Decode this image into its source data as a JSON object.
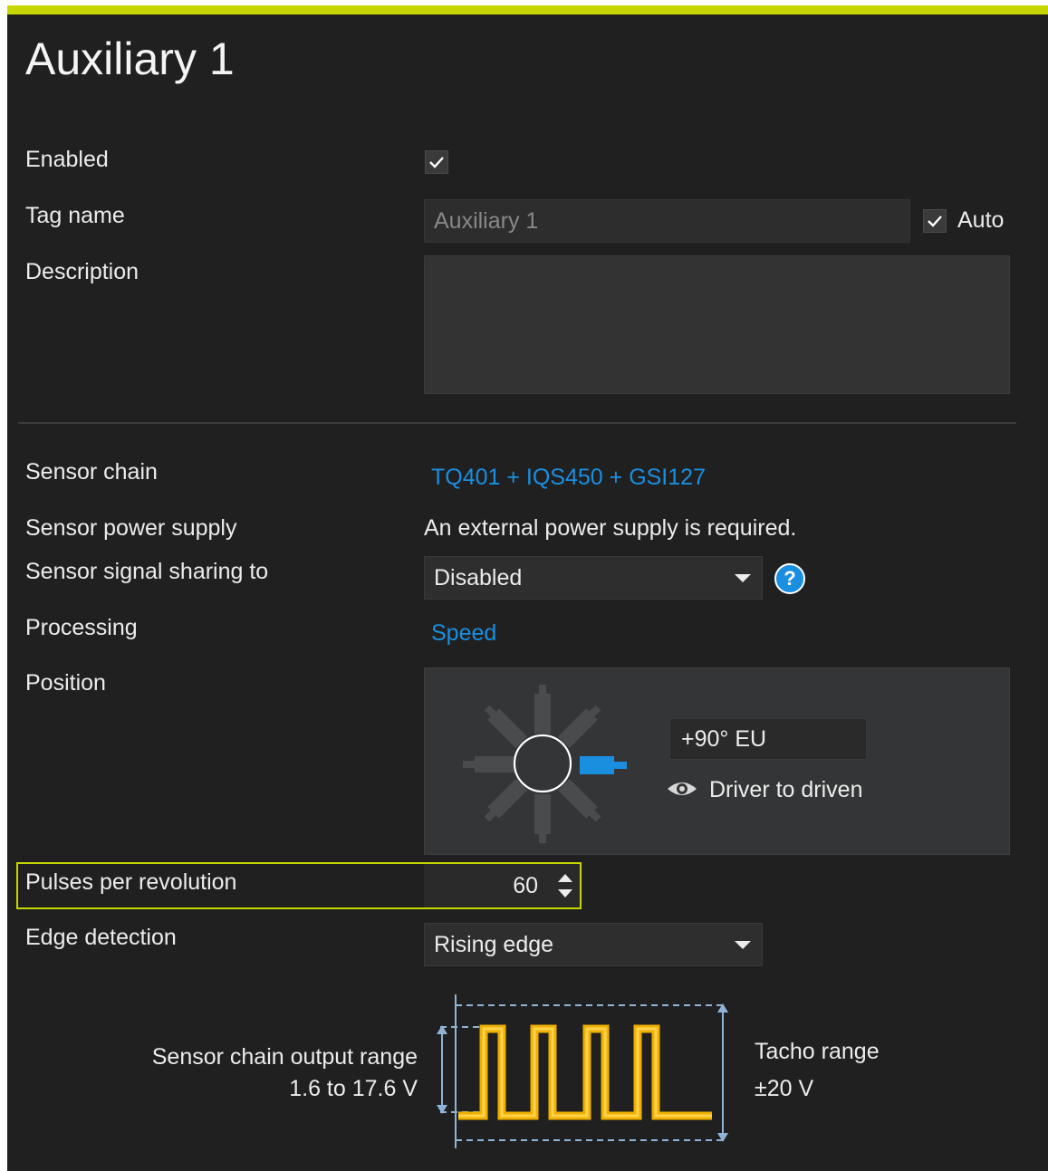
{
  "title": "Auxiliary 1",
  "general": {
    "enabled_label": "Enabled",
    "enabled_checked": true,
    "tag_name_label": "Tag name",
    "tag_name_value": "Auxiliary 1",
    "auto_label": "Auto",
    "auto_checked": true,
    "description_label": "Description",
    "description_value": ""
  },
  "sensor": {
    "chain_label": "Sensor chain",
    "chain_value": "TQ401 + IQS450 + GSI127",
    "power_label": "Sensor power supply",
    "power_value": "An external power supply is required.",
    "sharing_label": "Sensor signal sharing to",
    "sharing_value": "Disabled",
    "processing_label": "Processing",
    "processing_value": "Speed",
    "position_label": "Position",
    "position_angle": "+90° EU",
    "position_view": "Driver to driven",
    "pulses_label": "Pulses per revolution",
    "pulses_value": "60",
    "edge_label": "Edge detection",
    "edge_value": "Rising edge"
  },
  "diagram": {
    "output_range_label": "Sensor chain output range",
    "output_range_value": "1.6 to 17.6 V",
    "tacho_range_label": "Tacho range",
    "tacho_range_value": "±20 V"
  },
  "colors": {
    "accent": "#c6d600",
    "link": "#1a8fe0",
    "background": "#202020",
    "waveform": "#f0b000"
  },
  "icons": {
    "checkbox": "check-icon",
    "help": "help-icon",
    "dropdown": "chevron-down-icon",
    "view": "eye-icon",
    "spinner": "spinner-arrows-icon"
  }
}
